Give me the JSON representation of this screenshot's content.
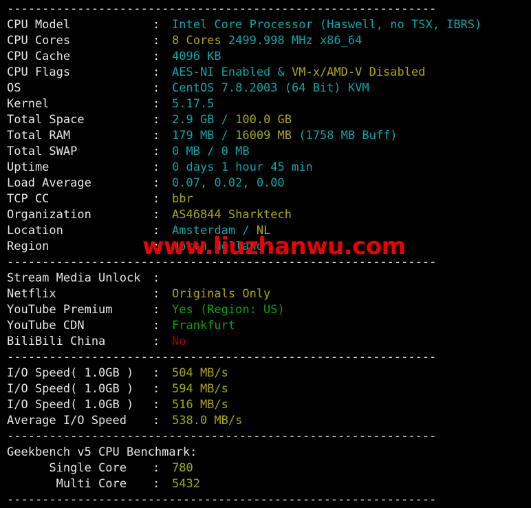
{
  "terminal": {
    "separator": "-------------------------------------------------------------",
    "watermark": "www.liuzhanwu.com",
    "colon": ":",
    "colors": {
      "cyan": "#00aaaa",
      "yellow": "#aaaa00",
      "green": "#00aa00",
      "red": "#aa0000",
      "white": "#e6e6e6",
      "background": "#000000",
      "watermark": "#ee0000"
    },
    "sections": [
      {
        "name": "system-info",
        "rows": [
          {
            "label": "CPU Model",
            "parts": [
              {
                "text": "Intel Core Processor (Haswell, no TSX, IBRS)",
                "color": "cyan"
              }
            ]
          },
          {
            "label": "CPU Cores",
            "parts": [
              {
                "text": "8 Cores ",
                "color": "yellow"
              },
              {
                "text": "2499.998 MHz x86_64",
                "color": "cyan"
              }
            ]
          },
          {
            "label": "CPU Cache",
            "parts": [
              {
                "text": "4096 KB",
                "color": "cyan"
              }
            ]
          },
          {
            "label": "CPU Flags",
            "parts": [
              {
                "text": "AES-NI Enabled & ",
                "color": "cyan"
              },
              {
                "text": "VM-x/AMD-V Disabled",
                "color": "yellow"
              }
            ]
          },
          {
            "label": "OS",
            "parts": [
              {
                "text": "CentOS 7.8.2003 (64 Bit) KVM",
                "color": "cyan"
              }
            ]
          },
          {
            "label": "Kernel",
            "parts": [
              {
                "text": "5.17.5",
                "color": "cyan"
              }
            ]
          },
          {
            "label": "Total Space",
            "parts": [
              {
                "text": "2.9 GB / ",
                "color": "cyan"
              },
              {
                "text": "100.0 GB",
                "color": "yellow"
              }
            ]
          },
          {
            "label": "Total RAM",
            "parts": [
              {
                "text": "179 MB / ",
                "color": "cyan"
              },
              {
                "text": "16009 MB ",
                "color": "yellow"
              },
              {
                "text": "(1758 MB Buff)",
                "color": "cyan"
              }
            ]
          },
          {
            "label": "Total SWAP",
            "parts": [
              {
                "text": "0 MB / 0 MB",
                "color": "cyan"
              }
            ]
          },
          {
            "label": "Uptime",
            "parts": [
              {
                "text": "0 days 1 hour 45 min",
                "color": "cyan"
              }
            ]
          },
          {
            "label": "Load Average",
            "parts": [
              {
                "text": "0.07, 0.02, 0.00",
                "color": "cyan"
              }
            ]
          },
          {
            "label": "TCP CC",
            "parts": [
              {
                "text": "bbr",
                "color": "yellow"
              }
            ]
          },
          {
            "label": "Organization",
            "parts": [
              {
                "text": "AS46844 Sharktech",
                "color": "yellow"
              }
            ]
          },
          {
            "label": "Location",
            "parts": [
              {
                "text": "Amsterdam / ",
                "color": "cyan"
              },
              {
                "text": "NL",
                "color": "yellow"
              }
            ]
          },
          {
            "label": "Region",
            "parts": [
              {
                "text": "North Holland",
                "color": "cyan"
              }
            ]
          }
        ]
      },
      {
        "name": "stream-media-unlock",
        "rows": [
          {
            "label": "Stream Media Unlock",
            "parts": []
          },
          {
            "label": "Netflix",
            "parts": [
              {
                "text": "Originals Only",
                "color": "yellow"
              }
            ]
          },
          {
            "label": "YouTube Premium",
            "parts": [
              {
                "text": "Yes (Region: US)",
                "color": "green"
              }
            ]
          },
          {
            "label": "YouTube CDN",
            "parts": [
              {
                "text": "Frankfurt",
                "color": "green"
              }
            ]
          },
          {
            "label": "BiliBili China",
            "parts": [
              {
                "text": "No",
                "color": "red"
              }
            ]
          }
        ]
      },
      {
        "name": "io-speed",
        "rows": [
          {
            "label": "I/O Speed( 1.0GB )",
            "parts": [
              {
                "text": "504 MB/s",
                "color": "yellow"
              }
            ]
          },
          {
            "label": "I/O Speed( 1.0GB )",
            "parts": [
              {
                "text": "594 MB/s",
                "color": "yellow"
              }
            ]
          },
          {
            "label": "I/O Speed( 1.0GB )",
            "parts": [
              {
                "text": "516 MB/s",
                "color": "yellow"
              }
            ]
          },
          {
            "label": "Average I/O Speed",
            "parts": [
              {
                "text": "538.0 MB/s",
                "color": "yellow"
              }
            ]
          }
        ]
      },
      {
        "name": "geekbench",
        "heading": "Geekbench v5 CPU Benchmark:",
        "rows": [
          {
            "label": "      Single Core",
            "parts": [
              {
                "text": "780",
                "color": "yellow"
              }
            ]
          },
          {
            "label": "       Multi Core",
            "parts": [
              {
                "text": "5432",
                "color": "yellow"
              }
            ]
          }
        ]
      }
    ]
  }
}
